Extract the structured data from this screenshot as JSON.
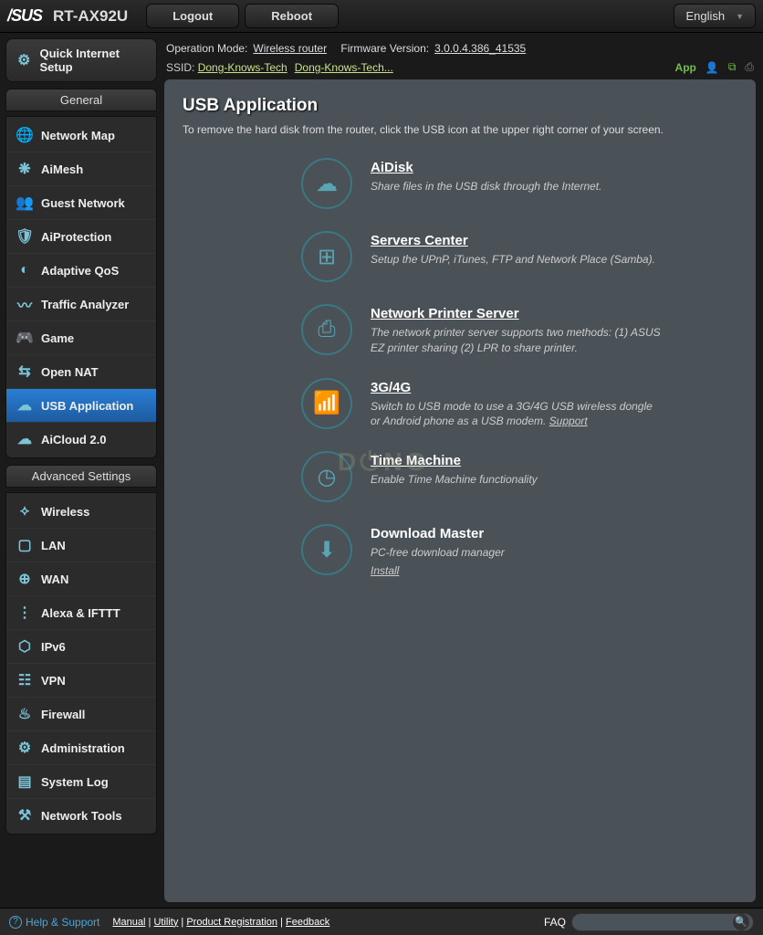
{
  "header": {
    "brand": "/SUS",
    "model": "RT-AX92U",
    "logout": "Logout",
    "reboot": "Reboot",
    "language": "English"
  },
  "status": {
    "op_mode_label": "Operation Mode:",
    "op_mode": "Wireless router",
    "fw_label": "Firmware Version:",
    "fw": "3.0.0.4.386_41535",
    "ssid_label": "SSID:",
    "ssid1": "Dong-Knows-Tech",
    "ssid2": "Dong-Knows-Tech...",
    "app": "App"
  },
  "quick": {
    "label": "Quick Internet Setup"
  },
  "general_hdr": "General",
  "general": [
    {
      "label": "Network Map",
      "icon": "globe"
    },
    {
      "label": "AiMesh",
      "icon": "mesh"
    },
    {
      "label": "Guest Network",
      "icon": "guest"
    },
    {
      "label": "AiProtection",
      "icon": "shield"
    },
    {
      "label": "Adaptive QoS",
      "icon": "gauge"
    },
    {
      "label": "Traffic Analyzer",
      "icon": "pulse"
    },
    {
      "label": "Game",
      "icon": "gamepad"
    },
    {
      "label": "Open NAT",
      "icon": "nat"
    },
    {
      "label": "USB Application",
      "icon": "cloud"
    },
    {
      "label": "AiCloud 2.0",
      "icon": "cloud2"
    }
  ],
  "advanced_hdr": "Advanced Settings",
  "advanced": [
    {
      "label": "Wireless",
      "icon": "wifi"
    },
    {
      "label": "LAN",
      "icon": "lan"
    },
    {
      "label": "WAN",
      "icon": "wan"
    },
    {
      "label": "Alexa & IFTTT",
      "icon": "dots"
    },
    {
      "label": "IPv6",
      "icon": "ipv6"
    },
    {
      "label": "VPN",
      "icon": "vpn"
    },
    {
      "label": "Firewall",
      "icon": "fire"
    },
    {
      "label": "Administration",
      "icon": "admin"
    },
    {
      "label": "System Log",
      "icon": "log"
    },
    {
      "label": "Network Tools",
      "icon": "tools"
    }
  ],
  "panel": {
    "title": "USB Application",
    "subtitle": "To remove the hard disk from the router, click the USB icon at the upper right corner of your screen."
  },
  "apps": [
    {
      "title": "AiDisk",
      "desc": "Share files in the USB disk through the Internet.",
      "icon": "disk"
    },
    {
      "title": "Servers Center",
      "desc": "Setup the UPnP, iTunes, FTP and Network Place (Samba).",
      "icon": "server"
    },
    {
      "title": "Network Printer Server",
      "desc": "The network printer server supports two methods: (1) ASUS EZ printer sharing (2) LPR to share printer.",
      "icon": "printer"
    },
    {
      "title": "3G/4G",
      "desc": "Switch to USB mode to use a 3G/4G USB wireless dongle or Android phone as a USB modem. ",
      "link": "Support",
      "icon": "4g"
    },
    {
      "title": "Time Machine",
      "desc": "Enable Time Machine functionality",
      "icon": "clock"
    },
    {
      "title": "Download Master",
      "desc": "PC-free download manager",
      "link": "Install",
      "icon": "download",
      "linkblock": true,
      "nou": true
    }
  ],
  "footer": {
    "help": "Help & Support",
    "links": "Manual | Utility | Product Registration | Feedback",
    "l1": "Manual",
    "l2": "Utility",
    "l3": "Product Registration",
    "l4": "Feedback",
    "faq": "FAQ"
  }
}
